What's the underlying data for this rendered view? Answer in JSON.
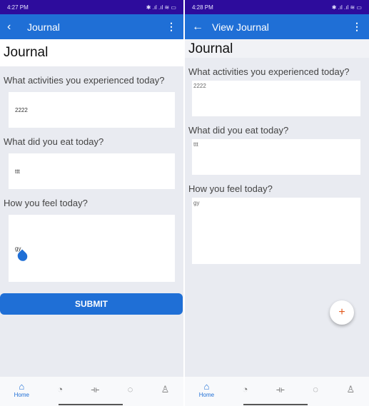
{
  "screens": [
    {
      "status": {
        "time": "4:27 PM",
        "icons": "✱ .ıl .ıl ≋ ▭"
      },
      "appbar": {
        "title": "Journal",
        "back_icon": "chevron-left",
        "menu_icon": "kebab"
      },
      "page_title": "Journal",
      "questions": [
        {
          "label": "What activities you experienced today?",
          "value": "2222"
        },
        {
          "label": "What did you eat today?",
          "value": "ttt"
        },
        {
          "label": "How you feel today?",
          "value": "gy"
        }
      ],
      "submit_label": "SUBMIT"
    },
    {
      "status": {
        "time": "4:28 PM",
        "icons": "✱ .ıl .ıl ≋ ▭"
      },
      "appbar": {
        "title": "View Journal",
        "back_icon": "arrow-left",
        "menu_icon": "kebab"
      },
      "page_title": "Journal",
      "questions": [
        {
          "label": "What activities you experienced today?",
          "value": "2222"
        },
        {
          "label": "What did you eat today?",
          "value": "ttt"
        },
        {
          "label": "How you feel today?",
          "value": "gy"
        }
      ],
      "fab_label": "+"
    }
  ],
  "nav": {
    "home_label": "Home"
  },
  "colors": {
    "primary": "#1f6fd6",
    "status": "#2d0c9c",
    "fab": "#e2571b"
  }
}
